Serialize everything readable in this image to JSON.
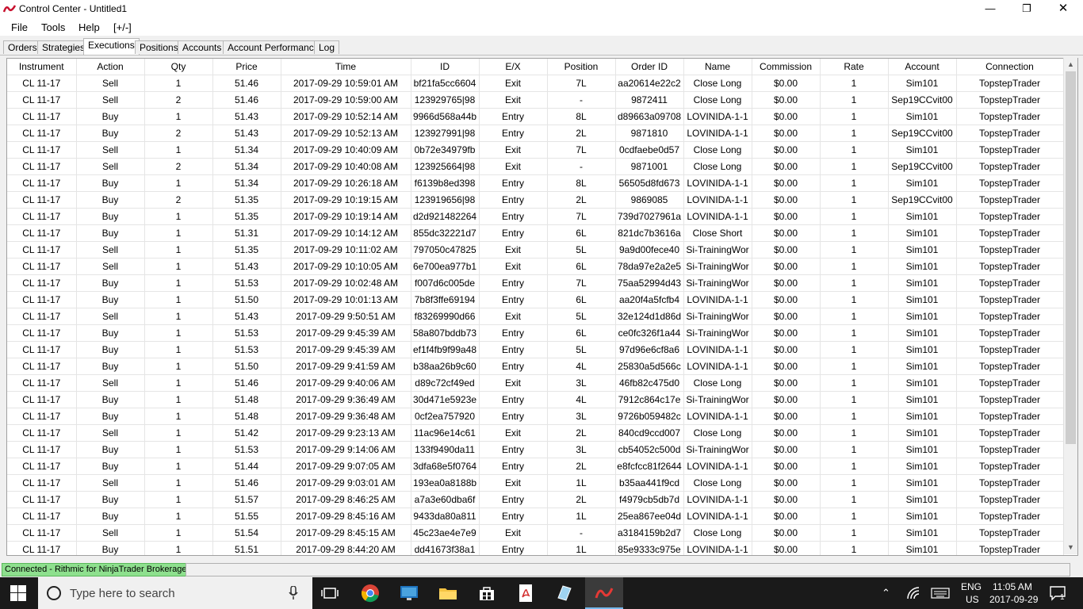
{
  "window": {
    "title": "Control Center - Untitled1"
  },
  "menu": [
    "File",
    "Tools",
    "Help",
    "[+/-]"
  ],
  "tabs": [
    "Orders",
    "Strategies",
    "Executions",
    "Positions",
    "Accounts",
    "Account Performance",
    "Log"
  ],
  "active_tab": "Executions",
  "columns": [
    "Instrument",
    "Action",
    "Qty",
    "Price",
    "Time",
    "ID",
    "E/X",
    "Position",
    "Order ID",
    "Name",
    "Commission",
    "Rate",
    "Account",
    "Connection"
  ],
  "rows": [
    [
      "CL 11-17",
      "Sell",
      "1",
      "51.46",
      "2017-09-29 10:59:01 AM",
      "bf21fa5cc6604",
      "Exit",
      "7L",
      "aa20614e22c2",
      "Close Long",
      "$0.00",
      "1",
      "Sim101",
      "TopstepTrader"
    ],
    [
      "CL 11-17",
      "Sell",
      "2",
      "51.46",
      "2017-09-29 10:59:00 AM",
      "123929765|98",
      "Exit",
      "-",
      "9872411",
      "Close Long",
      "$0.00",
      "1",
      "Sep19CCvit00",
      "TopstepTrader"
    ],
    [
      "CL 11-17",
      "Buy",
      "1",
      "51.43",
      "2017-09-29 10:52:14 AM",
      "9966d568a44b",
      "Entry",
      "8L",
      "d89663a09708",
      "LOVINIDA-1-1",
      "$0.00",
      "1",
      "Sim101",
      "TopstepTrader"
    ],
    [
      "CL 11-17",
      "Buy",
      "2",
      "51.43",
      "2017-09-29 10:52:13 AM",
      "123927991|98",
      "Entry",
      "2L",
      "9871810",
      "LOVINIDA-1-1",
      "$0.00",
      "1",
      "Sep19CCvit00",
      "TopstepTrader"
    ],
    [
      "CL 11-17",
      "Sell",
      "1",
      "51.34",
      "2017-09-29 10:40:09 AM",
      "0b72e34979fb",
      "Exit",
      "7L",
      "0cdfaebe0d57",
      "Close Long",
      "$0.00",
      "1",
      "Sim101",
      "TopstepTrader"
    ],
    [
      "CL 11-17",
      "Sell",
      "2",
      "51.34",
      "2017-09-29 10:40:08 AM",
      "123925664|98",
      "Exit",
      "-",
      "9871001",
      "Close Long",
      "$0.00",
      "1",
      "Sep19CCvit00",
      "TopstepTrader"
    ],
    [
      "CL 11-17",
      "Buy",
      "1",
      "51.34",
      "2017-09-29 10:26:18 AM",
      "f6139b8ed398",
      "Entry",
      "8L",
      "56505d8fd673",
      "LOVINIDA-1-1",
      "$0.00",
      "1",
      "Sim101",
      "TopstepTrader"
    ],
    [
      "CL 11-17",
      "Buy",
      "2",
      "51.35",
      "2017-09-29 10:19:15 AM",
      "123919656|98",
      "Entry",
      "2L",
      "9869085",
      "LOVINIDA-1-1",
      "$0.00",
      "1",
      "Sep19CCvit00",
      "TopstepTrader"
    ],
    [
      "CL 11-17",
      "Buy",
      "1",
      "51.35",
      "2017-09-29 10:19:14 AM",
      "d2d921482264",
      "Entry",
      "7L",
      "739d7027961a",
      "LOVINIDA-1-1",
      "$0.00",
      "1",
      "Sim101",
      "TopstepTrader"
    ],
    [
      "CL 11-17",
      "Buy",
      "1",
      "51.31",
      "2017-09-29 10:14:12 AM",
      "855dc32221d7",
      "Entry",
      "6L",
      "821dc7b3616a",
      "Close Short",
      "$0.00",
      "1",
      "Sim101",
      "TopstepTrader"
    ],
    [
      "CL 11-17",
      "Sell",
      "1",
      "51.35",
      "2017-09-29 10:11:02 AM",
      "797050c47825",
      "Exit",
      "5L",
      "9a9d00fece40",
      "Si-TrainingWor",
      "$0.00",
      "1",
      "Sim101",
      "TopstepTrader"
    ],
    [
      "CL 11-17",
      "Sell",
      "1",
      "51.43",
      "2017-09-29 10:10:05 AM",
      "6e700ea977b1",
      "Exit",
      "6L",
      "78da97e2a2e5",
      "Si-TrainingWor",
      "$0.00",
      "1",
      "Sim101",
      "TopstepTrader"
    ],
    [
      "CL 11-17",
      "Buy",
      "1",
      "51.53",
      "2017-09-29 10:02:48 AM",
      "f007d6c005de",
      "Entry",
      "7L",
      "75aa52994d43",
      "Si-TrainingWor",
      "$0.00",
      "1",
      "Sim101",
      "TopstepTrader"
    ],
    [
      "CL 11-17",
      "Buy",
      "1",
      "51.50",
      "2017-09-29 10:01:13 AM",
      "7b8f3ffe69194",
      "Entry",
      "6L",
      "aa20f4a5fcfb4",
      "LOVINIDA-1-1",
      "$0.00",
      "1",
      "Sim101",
      "TopstepTrader"
    ],
    [
      "CL 11-17",
      "Sell",
      "1",
      "51.43",
      "2017-09-29 9:50:51 AM",
      "f83269990d66",
      "Exit",
      "5L",
      "32e124d1d86d",
      "Si-TrainingWor",
      "$0.00",
      "1",
      "Sim101",
      "TopstepTrader"
    ],
    [
      "CL 11-17",
      "Buy",
      "1",
      "51.53",
      "2017-09-29 9:45:39 AM",
      "58a807bddb73",
      "Entry",
      "6L",
      "ce0fc326f1a44",
      "Si-TrainingWor",
      "$0.00",
      "1",
      "Sim101",
      "TopstepTrader"
    ],
    [
      "CL 11-17",
      "Buy",
      "1",
      "51.53",
      "2017-09-29 9:45:39 AM",
      "ef1f4fb9f99a48",
      "Entry",
      "5L",
      "97d96e6cf8a6",
      "LOVINIDA-1-1",
      "$0.00",
      "1",
      "Sim101",
      "TopstepTrader"
    ],
    [
      "CL 11-17",
      "Buy",
      "1",
      "51.50",
      "2017-09-29 9:41:59 AM",
      "b38aa26b9c60",
      "Entry",
      "4L",
      "25830a5d566c",
      "LOVINIDA-1-1",
      "$0.00",
      "1",
      "Sim101",
      "TopstepTrader"
    ],
    [
      "CL 11-17",
      "Sell",
      "1",
      "51.46",
      "2017-09-29 9:40:06 AM",
      "d89c72cf49ed",
      "Exit",
      "3L",
      "46fb82c475d0",
      "Close Long",
      "$0.00",
      "1",
      "Sim101",
      "TopstepTrader"
    ],
    [
      "CL 11-17",
      "Buy",
      "1",
      "51.48",
      "2017-09-29 9:36:49 AM",
      "30d471e5923e",
      "Entry",
      "4L",
      "7912c864c17e",
      "Si-TrainingWor",
      "$0.00",
      "1",
      "Sim101",
      "TopstepTrader"
    ],
    [
      "CL 11-17",
      "Buy",
      "1",
      "51.48",
      "2017-09-29 9:36:48 AM",
      "0cf2ea757920",
      "Entry",
      "3L",
      "9726b059482c",
      "LOVINIDA-1-1",
      "$0.00",
      "1",
      "Sim101",
      "TopstepTrader"
    ],
    [
      "CL 11-17",
      "Sell",
      "1",
      "51.42",
      "2017-09-29 9:23:13 AM",
      "11ac96e14c61",
      "Exit",
      "2L",
      "840cd9ccd007",
      "Close Long",
      "$0.00",
      "1",
      "Sim101",
      "TopstepTrader"
    ],
    [
      "CL 11-17",
      "Buy",
      "1",
      "51.53",
      "2017-09-29 9:14:06 AM",
      "133f9490da11",
      "Entry",
      "3L",
      "cb54052c500d",
      "Si-TrainingWor",
      "$0.00",
      "1",
      "Sim101",
      "TopstepTrader"
    ],
    [
      "CL 11-17",
      "Buy",
      "1",
      "51.44",
      "2017-09-29 9:07:05 AM",
      "3dfa68e5f0764",
      "Entry",
      "2L",
      "e8fcfcc81f2644",
      "LOVINIDA-1-1",
      "$0.00",
      "1",
      "Sim101",
      "TopstepTrader"
    ],
    [
      "CL 11-17",
      "Sell",
      "1",
      "51.46",
      "2017-09-29 9:03:01 AM",
      "193ea0a8188b",
      "Exit",
      "1L",
      "b35aa441f9cd",
      "Close Long",
      "$0.00",
      "1",
      "Sim101",
      "TopstepTrader"
    ],
    [
      "CL 11-17",
      "Buy",
      "1",
      "51.57",
      "2017-09-29 8:46:25 AM",
      "a7a3e60dba6f",
      "Entry",
      "2L",
      "f4979cb5db7d",
      "LOVINIDA-1-1",
      "$0.00",
      "1",
      "Sim101",
      "TopstepTrader"
    ],
    [
      "CL 11-17",
      "Buy",
      "1",
      "51.55",
      "2017-09-29 8:45:16 AM",
      "9433da80a811",
      "Entry",
      "1L",
      "25ea867ee04d",
      "LOVINIDA-1-1",
      "$0.00",
      "1",
      "Sim101",
      "TopstepTrader"
    ],
    [
      "CL 11-17",
      "Sell",
      "1",
      "51.54",
      "2017-09-29 8:45:15 AM",
      "45c23ae4e7e9",
      "Exit",
      "-",
      "a3184159b2d7",
      "Close Long",
      "$0.00",
      "1",
      "Sim101",
      "TopstepTrader"
    ],
    [
      "CL 11-17",
      "Buy",
      "1",
      "51.51",
      "2017-09-29 8:44:20 AM",
      "dd41673f38a1",
      "Entry",
      "1L",
      "85e9333c975e",
      "LOVINIDA-1-1",
      "$0.00",
      "1",
      "Sim101",
      "TopstepTrader"
    ]
  ],
  "status": {
    "connection": "Connected - Rithmic for NinjaTrader Brokerage",
    "connection_color": "#8ee08e"
  },
  "taskbar": {
    "search_placeholder": "Type here to search",
    "language": "ENG",
    "region": "US",
    "time": "11:05 AM",
    "date": "2017-09-29",
    "notification_count": "1"
  }
}
